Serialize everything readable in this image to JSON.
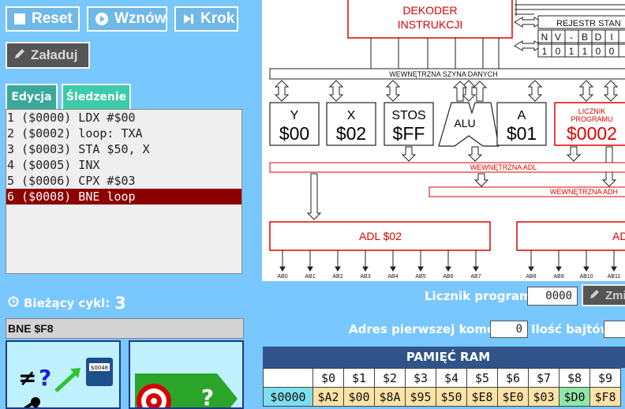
{
  "toolbar": {
    "reset_label": "Reset",
    "resume_label": "Wznów",
    "step_label": "Krok",
    "load_label": "Załaduj"
  },
  "tabs": [
    {
      "label": "Edycja",
      "color": "#3aa89a"
    },
    {
      "label": "Śledzenie",
      "color": "#3ecba9"
    }
  ],
  "code_lines": [
    "1 ($0000) LDX #$00",
    "2 ($0002) loop: TXA",
    "3 ($0003) STA $50, X",
    "4 ($0005) INX",
    "5 ($0006) CPX #$03",
    "6 ($0008) BNE loop"
  ],
  "highlighted_line": 6,
  "cycle": {
    "label": "Bieżący cykl:",
    "value": "3"
  },
  "current_instruction": "BNE $F8",
  "diagram": {
    "decoder": [
      "DEKODER",
      "INSTRUKCJI"
    ],
    "status_reg_title": "REJESTR STAN",
    "status_flags": [
      "N",
      "V",
      "-",
      "B",
      "D",
      "I"
    ],
    "status_bits": [
      "1",
      "0",
      "1",
      "1",
      "0",
      "0"
    ],
    "internal_bus": "WEWNĘTRZNA SZYNA DANYCH",
    "reg_y": {
      "name": "Y",
      "value": "$00"
    },
    "reg_x": {
      "name": "X",
      "value": "$02"
    },
    "reg_sp": {
      "name": "STOS",
      "value": "$FF"
    },
    "alu": "ALU",
    "reg_a": {
      "name": "A",
      "value": "$01"
    },
    "pc": {
      "name1": "LICZNIK",
      "name2": "PROGRAMU",
      "value": "$0002"
    },
    "adl_bus": "WEWNĘTRZNA ADL",
    "adh_bus": "WEWNĘTRZNA ADH",
    "adl": "ADL $02",
    "adh": "AD",
    "ab_low": [
      "AB0",
      "AB1",
      "AB2",
      "AB3",
      "AB4",
      "AB5",
      "AB6",
      "AB7"
    ],
    "ab_high": [
      "AB8",
      "AB9",
      "AB10",
      "AB11"
    ],
    "red": "#e00000"
  },
  "pc_field": {
    "label": "Licznik programu:",
    "value": "0000"
  },
  "change_label": "Zmi",
  "ram_addr": {
    "label": "Adres pierwszej komórki:",
    "value": "0"
  },
  "byte_count_label": "Ilość bajtów:",
  "ram": {
    "title": "PAMIĘĆ RAM",
    "headers": [
      "",
      "$0",
      "$1",
      "$2",
      "$3",
      "$4",
      "$5",
      "$6",
      "$7",
      "$8",
      "$9"
    ],
    "row_addr": "$0000",
    "row_values": [
      "$A2",
      "$00",
      "$8A",
      "$95",
      "$50",
      "$E8",
      "$E0",
      "$03",
      "$D0",
      "$F8"
    ]
  },
  "cards": {
    "chip_label": "$0048"
  }
}
